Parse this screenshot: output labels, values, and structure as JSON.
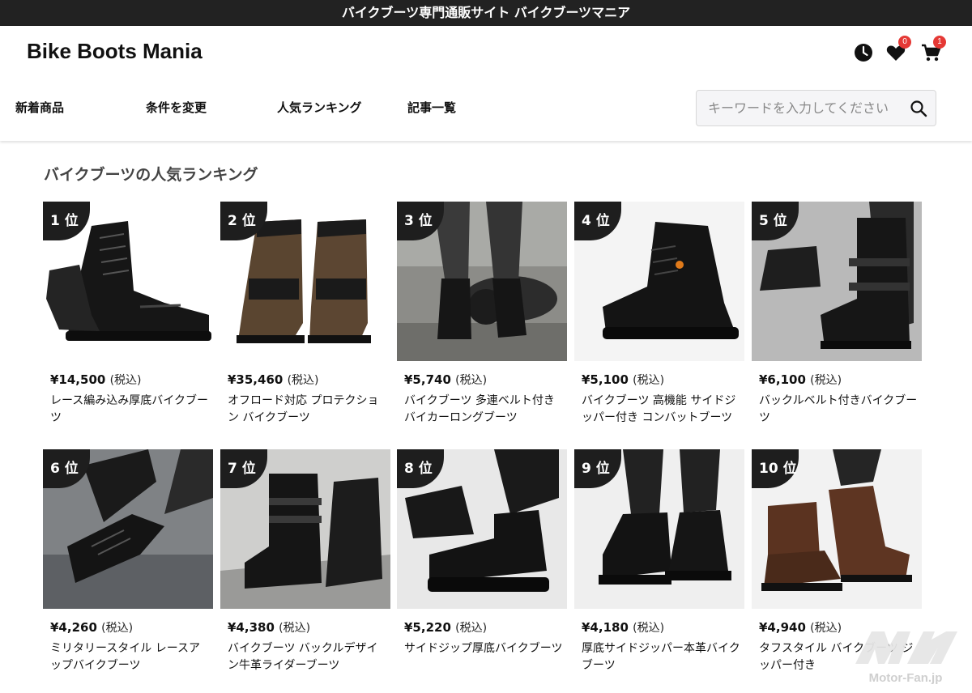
{
  "topbar": {
    "text": "バイクブーツ専門通販サイト バイクブーツマニア"
  },
  "header": {
    "logo": "Bike Boots Mania",
    "favorites_count": "0",
    "cart_count": "1"
  },
  "nav": {
    "items": [
      {
        "label": "新着商品"
      },
      {
        "label": "条件を変更"
      },
      {
        "label": "人気ランキング"
      },
      {
        "label": "記事一覧"
      }
    ]
  },
  "search": {
    "placeholder": "キーワードを入力してください"
  },
  "ranking": {
    "title": "バイクブーツの人気ランキング",
    "tax_label": "(税込)",
    "items": [
      {
        "rank": "1 位",
        "price": "¥14,500",
        "name": "レース編み込み厚底バイクブーツ"
      },
      {
        "rank": "2 位",
        "price": "¥35,460",
        "name": "オフロード対応 プロテクション バイクブーツ"
      },
      {
        "rank": "3 位",
        "price": "¥5,740",
        "name": "バイクブーツ 多連ベルト付きバイカーロングブーツ"
      },
      {
        "rank": "4 位",
        "price": "¥5,100",
        "name": "バイクブーツ 高機能 サイドジッパー付き コンバットブーツ"
      },
      {
        "rank": "5 位",
        "price": "¥6,100",
        "name": "バックルベルト付きバイクブーツ"
      },
      {
        "rank": "6 位",
        "price": "¥4,260",
        "name": "ミリタリースタイル レースアップバイクブーツ"
      },
      {
        "rank": "7 位",
        "price": "¥4,380",
        "name": "バイクブーツ バックルデザイン牛革ライダーブーツ"
      },
      {
        "rank": "8 位",
        "price": "¥5,220",
        "name": "サイドジップ厚底バイクブーツ"
      },
      {
        "rank": "9 位",
        "price": "¥4,180",
        "name": "厚底サイドジッパー本革バイクブーツ"
      },
      {
        "rank": "10 位",
        "price": "¥4,940",
        "name": "タフスタイル バイクブーツ ジッパー付き"
      }
    ]
  },
  "watermark": {
    "text": "Motor-Fan.jp"
  },
  "colors": {
    "badge": "#e53935",
    "topbar": "#222222",
    "rank_tag": "#1e1e1e"
  }
}
